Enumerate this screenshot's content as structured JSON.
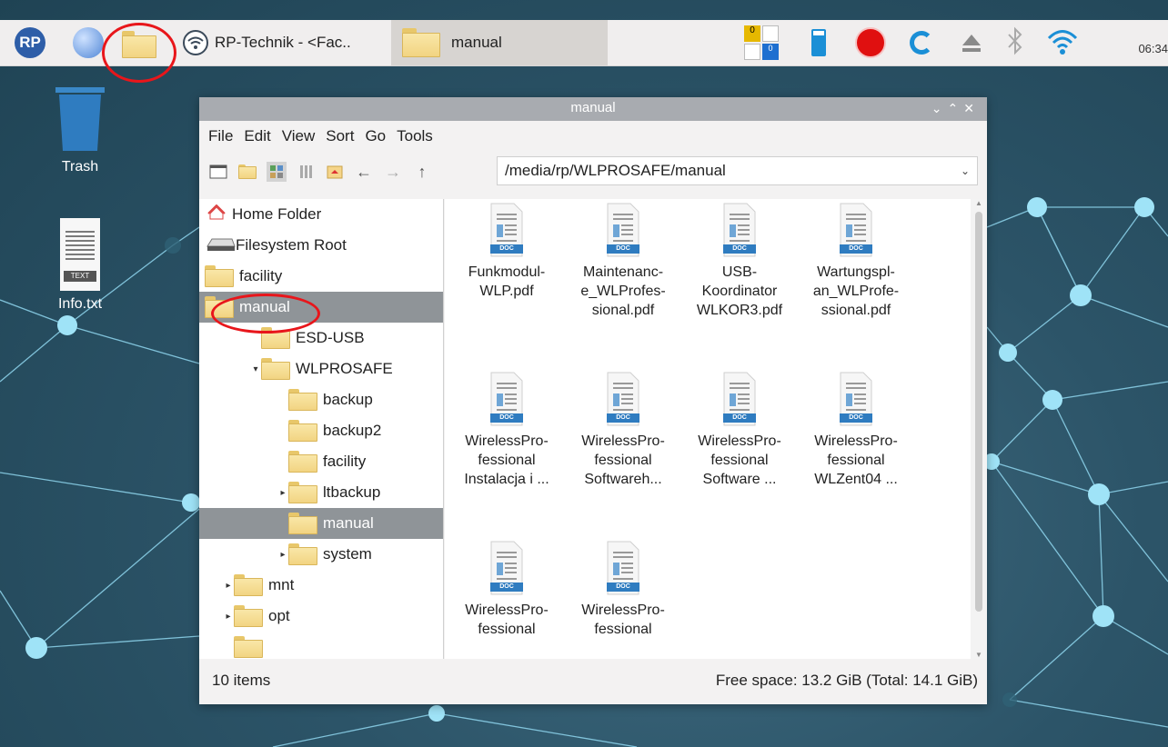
{
  "taskbar": {
    "app_title": "RP-Technik - <Fac..",
    "folder_window": "manual",
    "clock": "06:34"
  },
  "desktop": {
    "icons": [
      {
        "label": "Trash",
        "icon": "trash-icon"
      },
      {
        "label": "Info.txt",
        "icon": "text-file-icon",
        "badge": "TEXT"
      }
    ]
  },
  "window": {
    "title": "manual",
    "menu": [
      "File",
      "Edit",
      "View",
      "Sort",
      "Go",
      "Tools"
    ],
    "path": "/media/rp/WLPROSAFE/manual",
    "tree": [
      {
        "label": "Home Folder",
        "icon": "home-icon",
        "indent": 0
      },
      {
        "label": "Filesystem Root",
        "icon": "drive-icon",
        "indent": 0
      },
      {
        "label": "facility",
        "icon": "folder-icon",
        "indent": 0
      },
      {
        "label": "manual",
        "icon": "folder-icon",
        "indent": 0,
        "selected": true
      },
      {
        "label": "ESD-USB",
        "icon": "folder-icon",
        "indent": 2
      },
      {
        "label": "WLPROSAFE",
        "icon": "folder-icon",
        "indent": 2,
        "expander": "open"
      },
      {
        "label": "backup",
        "icon": "folder-icon",
        "indent": 3
      },
      {
        "label": "backup2",
        "icon": "folder-icon",
        "indent": 3
      },
      {
        "label": "facility",
        "icon": "folder-icon",
        "indent": 3
      },
      {
        "label": "ltbackup",
        "icon": "folder-icon",
        "indent": 3,
        "expander": "closed"
      },
      {
        "label": "manual",
        "icon": "folder-icon",
        "indent": 3,
        "selected": true
      },
      {
        "label": "system",
        "icon": "folder-icon",
        "indent": 3,
        "expander": "closed"
      },
      {
        "label": "mnt",
        "icon": "folder-icon",
        "indent": 1,
        "expander": "closed"
      },
      {
        "label": "opt",
        "icon": "folder-icon",
        "indent": 1,
        "expander": "closed"
      },
      {
        "label": "",
        "icon": "folder-icon",
        "indent": 1
      }
    ],
    "files": [
      {
        "lines": [
          "Funkmodul-",
          "WLP.pdf"
        ]
      },
      {
        "lines": [
          "Maintenanc-",
          "e_WLProfes-",
          "sional.pdf"
        ]
      },
      {
        "lines": [
          "USB-",
          "Koordinator",
          "WLKOR3.pdf"
        ]
      },
      {
        "lines": [
          "Wartungspl-",
          "an_WLProfe-",
          "ssional.pdf"
        ]
      },
      {
        "lines": [
          "WirelessPro-",
          "fessional",
          "Instalacja i ..."
        ]
      },
      {
        "lines": [
          "WirelessPro-",
          "fessional",
          "Softwareh..."
        ]
      },
      {
        "lines": [
          "WirelessPro-",
          "fessional",
          "Software ..."
        ]
      },
      {
        "lines": [
          "WirelessPro-",
          "fessional",
          "WLZent04 ..."
        ]
      },
      {
        "lines": [
          "WirelessPro-",
          "fessional"
        ]
      },
      {
        "lines": [
          "WirelessPro-",
          "fessional"
        ]
      }
    ],
    "doc_badge": "DOC",
    "status_left": "10 items",
    "status_right": "Free space: 13.2 GiB (Total: 14.1 GiB)"
  },
  "colors": {
    "highlight_ring": "#e8161b",
    "selection": "#8f9498",
    "network_node": "#9fe3f7"
  }
}
